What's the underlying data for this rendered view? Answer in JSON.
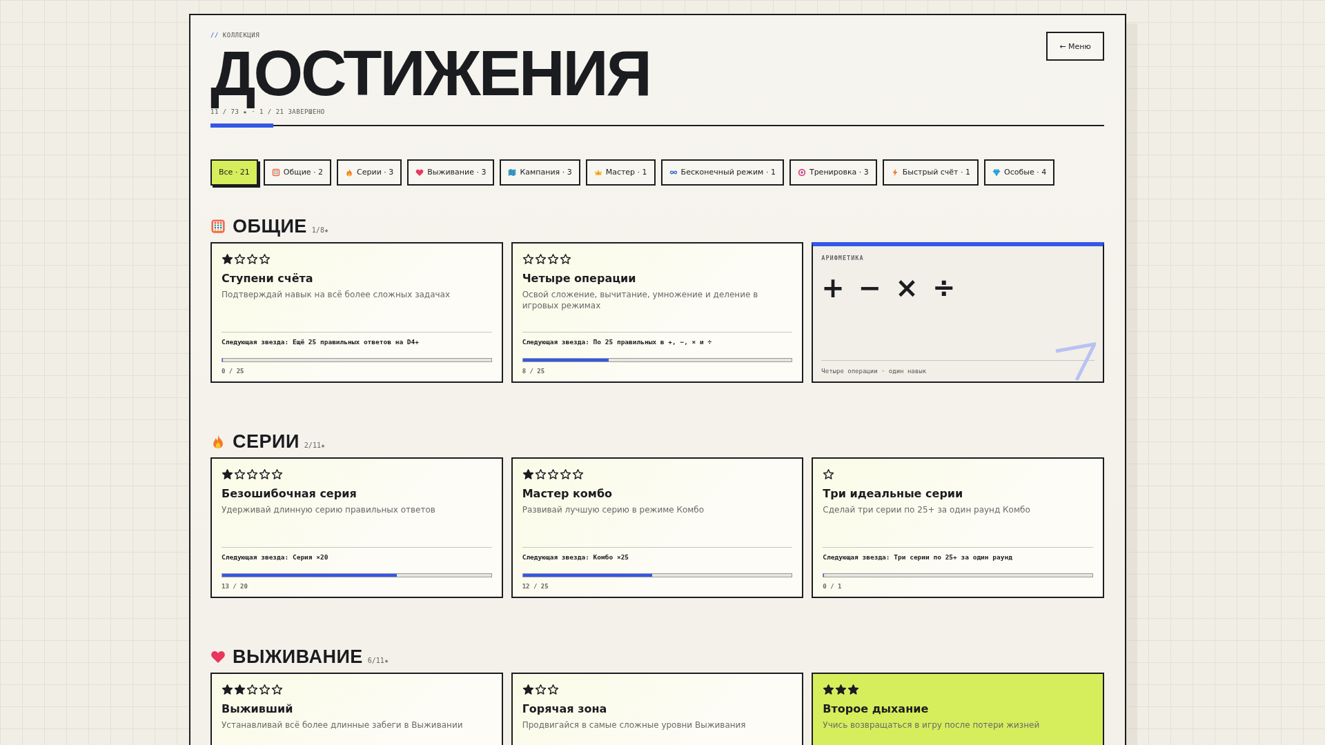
{
  "eyebrow_prefix": "//",
  "eyebrow": "КОЛЛЕКЦИЯ",
  "title": "ДОСТИЖЕНИЯ",
  "summary": "11 / 73 ★ · 1 / 21 ЗАВЕРШЕНО",
  "overall_progress": {
    "level": 0.07
  },
  "menu_button": "← Меню",
  "filters": [
    {
      "label": "Все · 21",
      "selected": true
    },
    {
      "label": "Общие · 2",
      "selected": false
    },
    {
      "label": "Серии · 3",
      "selected": false
    },
    {
      "label": "Выживание · 3",
      "selected": false
    },
    {
      "label": "Кампания · 3",
      "selected": false
    },
    {
      "label": "Мастер · 1",
      "selected": false
    },
    {
      "label": "Бесконечный режим · 1",
      "selected": false
    },
    {
      "label": "Тренировка · 3",
      "selected": false
    },
    {
      "label": "Быстрый счёт · 1",
      "selected": false
    },
    {
      "label": "Особые · 4",
      "selected": false
    }
  ],
  "sections": [
    {
      "title": "ОБЩИЕ",
      "count": "1/8★",
      "cards": [
        {
          "kind": "achievement",
          "star_slots": [
            {
              "filled": true
            },
            {
              "filled": false
            },
            {
              "filled": false
            },
            {
              "filled": false
            }
          ],
          "title": "Ступени счёта",
          "description": "Подтверждай навык на всё более сложных задачах",
          "next": "Следующая звезда: Ещё 25 правильных ответов на D4+",
          "level": 0,
          "progress": "0 / 25",
          "completed": false
        },
        {
          "kind": "achievement",
          "star_slots": [
            {
              "filled": false
            },
            {
              "filled": false
            },
            {
              "filled": false
            },
            {
              "filled": false
            }
          ],
          "title": "Четыре операции",
          "description": "Освой сложение, вычитание, умножение и деление в игровых режимах",
          "next": "Следующая звезда: По 25 правильных в +, −, × и ÷",
          "level": 0.32,
          "progress": "8 / 25",
          "completed": false
        },
        {
          "kind": "skill",
          "label": "АРИФМЕТИКА",
          "symbols": [
            "+",
            "−",
            "×",
            "÷"
          ],
          "footer": "Четыре операции · один навык"
        }
      ]
    },
    {
      "title": "СЕРИИ",
      "count": "2/11★",
      "cards": [
        {
          "kind": "achievement",
          "star_slots": [
            {
              "filled": true
            },
            {
              "filled": false
            },
            {
              "filled": false
            },
            {
              "filled": false
            },
            {
              "filled": false
            }
          ],
          "title": "Безошибочная серия",
          "description": "Удерживай длинную серию правильных ответов",
          "next": "Следующая звезда: Серия ×20",
          "level": 0.65,
          "progress": "13 / 20",
          "completed": false
        },
        {
          "kind": "achievement",
          "star_slots": [
            {
              "filled": true
            },
            {
              "filled": false
            },
            {
              "filled": false
            },
            {
              "filled": false
            },
            {
              "filled": false
            }
          ],
          "title": "Мастер комбо",
          "description": "Развивай лучшую серию в режиме Комбо",
          "next": "Следующая звезда: Комбо ×25",
          "level": 0.48,
          "progress": "12 / 25",
          "completed": false
        },
        {
          "kind": "achievement",
          "star_slots": [
            {
              "filled": false
            }
          ],
          "title": "Три идеальные серии",
          "description": "Сделай три серии по 25+ за один раунд Комбо",
          "next": "Следующая звезда: Три серии по 25+ за один раунд",
          "level": 0,
          "progress": "0 / 1",
          "completed": false
        }
      ]
    },
    {
      "title": "ВЫЖИВАНИЕ",
      "count": "6/11★",
      "cards": [
        {
          "kind": "achievement",
          "star_slots": [
            {
              "filled": true
            },
            {
              "filled": true
            },
            {
              "filled": false
            },
            {
              "filled": false
            },
            {
              "filled": false
            }
          ],
          "title": "Выживший",
          "description": "Устанавливай всё более длинные забеги в Выживании",
          "completed": false
        },
        {
          "kind": "achievement",
          "star_slots": [
            {
              "filled": true
            },
            {
              "filled": false
            },
            {
              "filled": false
            }
          ],
          "title": "Горячая зона",
          "description": "Продвигайся в самые сложные уровни Выживания",
          "completed": false
        },
        {
          "kind": "achievement",
          "star_slots": [
            {
              "filled": true
            },
            {
              "filled": true
            },
            {
              "filled": true
            }
          ],
          "title": "Второе дыхание",
          "description": "Учись возвращаться в игру после потери жизней",
          "completed": true
        }
      ]
    }
  ]
}
